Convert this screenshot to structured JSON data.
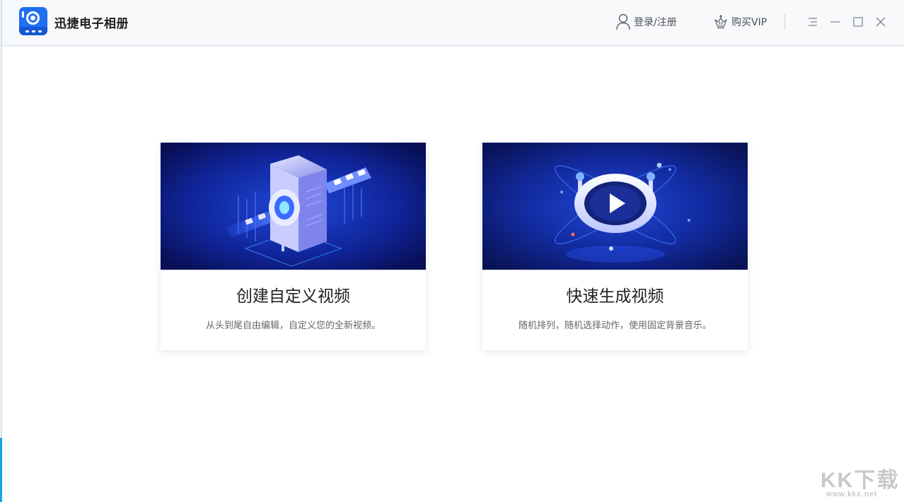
{
  "app": {
    "title": "迅捷电子相册"
  },
  "header": {
    "login_label": "登录/注册",
    "vip_label": "购买VIP"
  },
  "window_controls": [
    "menu-icon",
    "minimize-icon",
    "maximize-icon",
    "close-icon"
  ],
  "cards": [
    {
      "title": "创建自定义视频",
      "description": "从头到尾自由编辑，自定义您的全新视频。",
      "illustration": "film-projector-illustration"
    },
    {
      "title": "快速生成视频",
      "description": "随机排列，随机选择动作，使用固定背景音乐。",
      "illustration": "play-button-illustration"
    }
  ],
  "watermark": {
    "main": "KK下载",
    "sub": "www.kkx.net"
  },
  "colors": {
    "accent": "#1f6ff2",
    "banner_dark": "#0a1560",
    "banner_light": "#1e3fd0"
  }
}
